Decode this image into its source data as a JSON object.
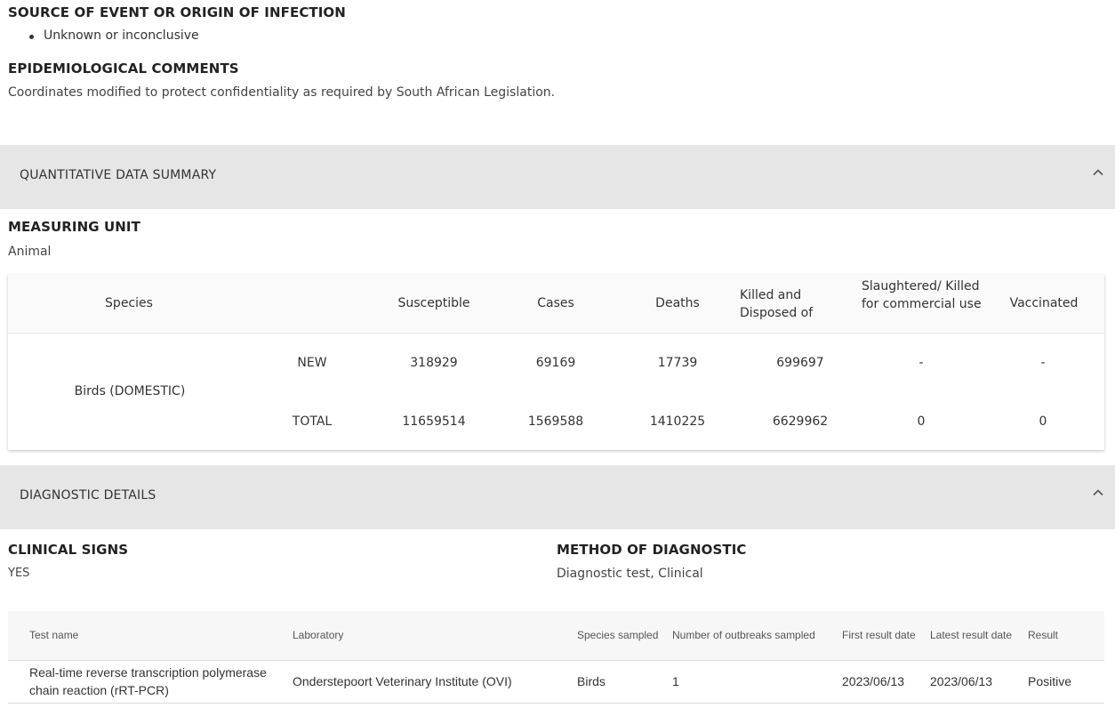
{
  "event": {
    "source_title": "SOURCE OF EVENT OR ORIGIN OF INFECTION",
    "source_items": [
      "Unknown or inconclusive"
    ],
    "epi_title": "EPIDEMIOLOGICAL COMMENTS",
    "epi_text": "Coordinates modified to protect confidentiality as required by South African Legislation."
  },
  "quantitative": {
    "panel_label": "QUANTITATIVE DATA SUMMARY",
    "measuring_unit_title": "MEASURING UNIT",
    "measuring_unit_value": "Animal",
    "headers": {
      "species": "Species",
      "susceptible": "Susceptible",
      "cases": "Cases",
      "deaths": "Deaths",
      "killed": "Killed and Disposed of",
      "slaughtered": "Slaughtered/ Killed for commercial use",
      "vaccinated": "Vaccinated"
    },
    "species_name": "Birds (DOMESTIC)",
    "rows": [
      {
        "label": "NEW",
        "susceptible": "318929",
        "cases": "69169",
        "deaths": "17739",
        "killed": "699697",
        "slaughtered": "-",
        "vaccinated": "-"
      },
      {
        "label": "TOTAL",
        "susceptible": "11659514",
        "cases": "1569588",
        "deaths": "1410225",
        "killed": "6629962",
        "slaughtered": "0",
        "vaccinated": "0"
      }
    ]
  },
  "diagnostic": {
    "panel_label": "DIAGNOSTIC DETAILS",
    "clinical_title": "CLINICAL SIGNS",
    "clinical_value": "YES",
    "method_title": "METHOD OF DIAGNOSTIC",
    "method_value": "Diagnostic test, Clinical",
    "headers": {
      "test_name": "Test name",
      "laboratory": "Laboratory",
      "species": "Species sampled",
      "outbreaks": "Number of outbreaks sampled",
      "first_date": "First result date",
      "latest_date": "Latest result date",
      "result": "Result"
    },
    "rows": [
      {
        "test_name": "Real-time reverse transcription polymerase chain reaction (rRT-PCR)",
        "laboratory": "Onderstepoort Veterinary Institute (OVI)",
        "species": "Birds",
        "outbreaks": "1",
        "first_date": "2023/06/13",
        "latest_date": "2023/06/13",
        "result": "Positive"
      }
    ]
  },
  "icons": {
    "collapse": "chevron-up-icon",
    "bullet": "bullet-icon"
  },
  "colors": {
    "panel_bg": "#e6e6e6",
    "table_head_bg": "#fafafa",
    "text": "#333333"
  }
}
